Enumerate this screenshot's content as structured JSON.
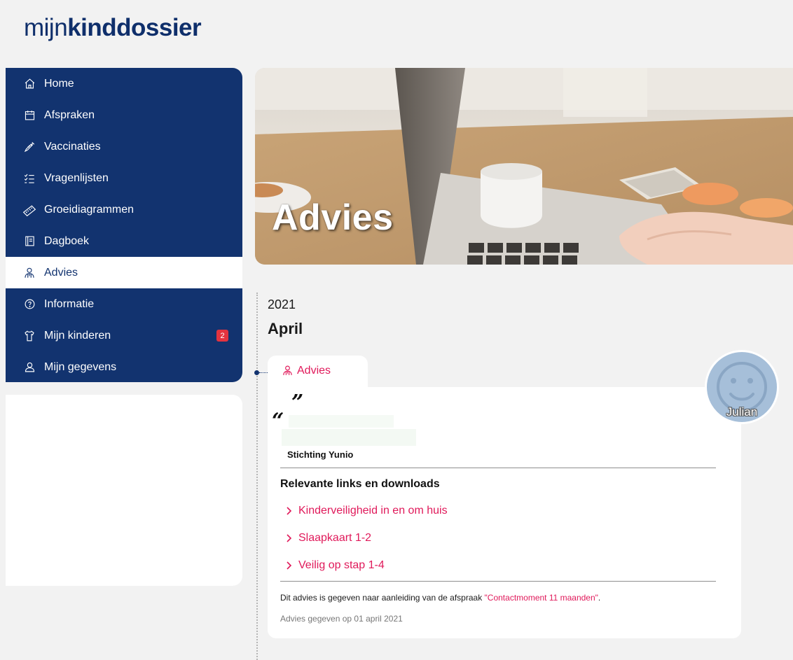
{
  "logo": {
    "light": "mijn",
    "bold": "kinddossier"
  },
  "nav": {
    "items": [
      {
        "label": "Home",
        "icon": "home-icon"
      },
      {
        "label": "Afspraken",
        "icon": "calendar-icon"
      },
      {
        "label": "Vaccinaties",
        "icon": "syringe-icon"
      },
      {
        "label": "Vragenlijsten",
        "icon": "checklist-icon"
      },
      {
        "label": "Groeidiagrammen",
        "icon": "ruler-icon"
      },
      {
        "label": "Dagboek",
        "icon": "book-icon"
      },
      {
        "label": "Advies",
        "icon": "advisor-icon",
        "active": true
      },
      {
        "label": "Informatie",
        "icon": "help-circle-icon"
      },
      {
        "label": "Mijn kinderen",
        "icon": "child-clothing-icon",
        "badge": "2"
      },
      {
        "label": "Mijn gegevens",
        "icon": "user-icon"
      }
    ]
  },
  "hero": {
    "title": "Advies"
  },
  "timeline": {
    "year": "2021",
    "month": "April"
  },
  "entry": {
    "tab_label": "Advies",
    "quote_close": "”",
    "quote_open": "“",
    "organization": "Stichting Yunio",
    "links_title": "Relevante links en downloads",
    "links": [
      "Kinderveiligheid in en om huis",
      "Slaapkaart 1-2",
      "Veilig op stap 1-4"
    ],
    "note_prefix": "Dit advies is gegeven naar aanleiding van de afspraak ",
    "note_link": "\"Contactmoment 11 maanden\"",
    "note_suffix": ".",
    "given": "Advies gegeven op 01 april 2021"
  },
  "child": {
    "name": "Julian"
  },
  "colors": {
    "navy": "#12336f",
    "accent": "#e0195a",
    "badge": "#e3333f",
    "background": "#f2f2f2"
  }
}
